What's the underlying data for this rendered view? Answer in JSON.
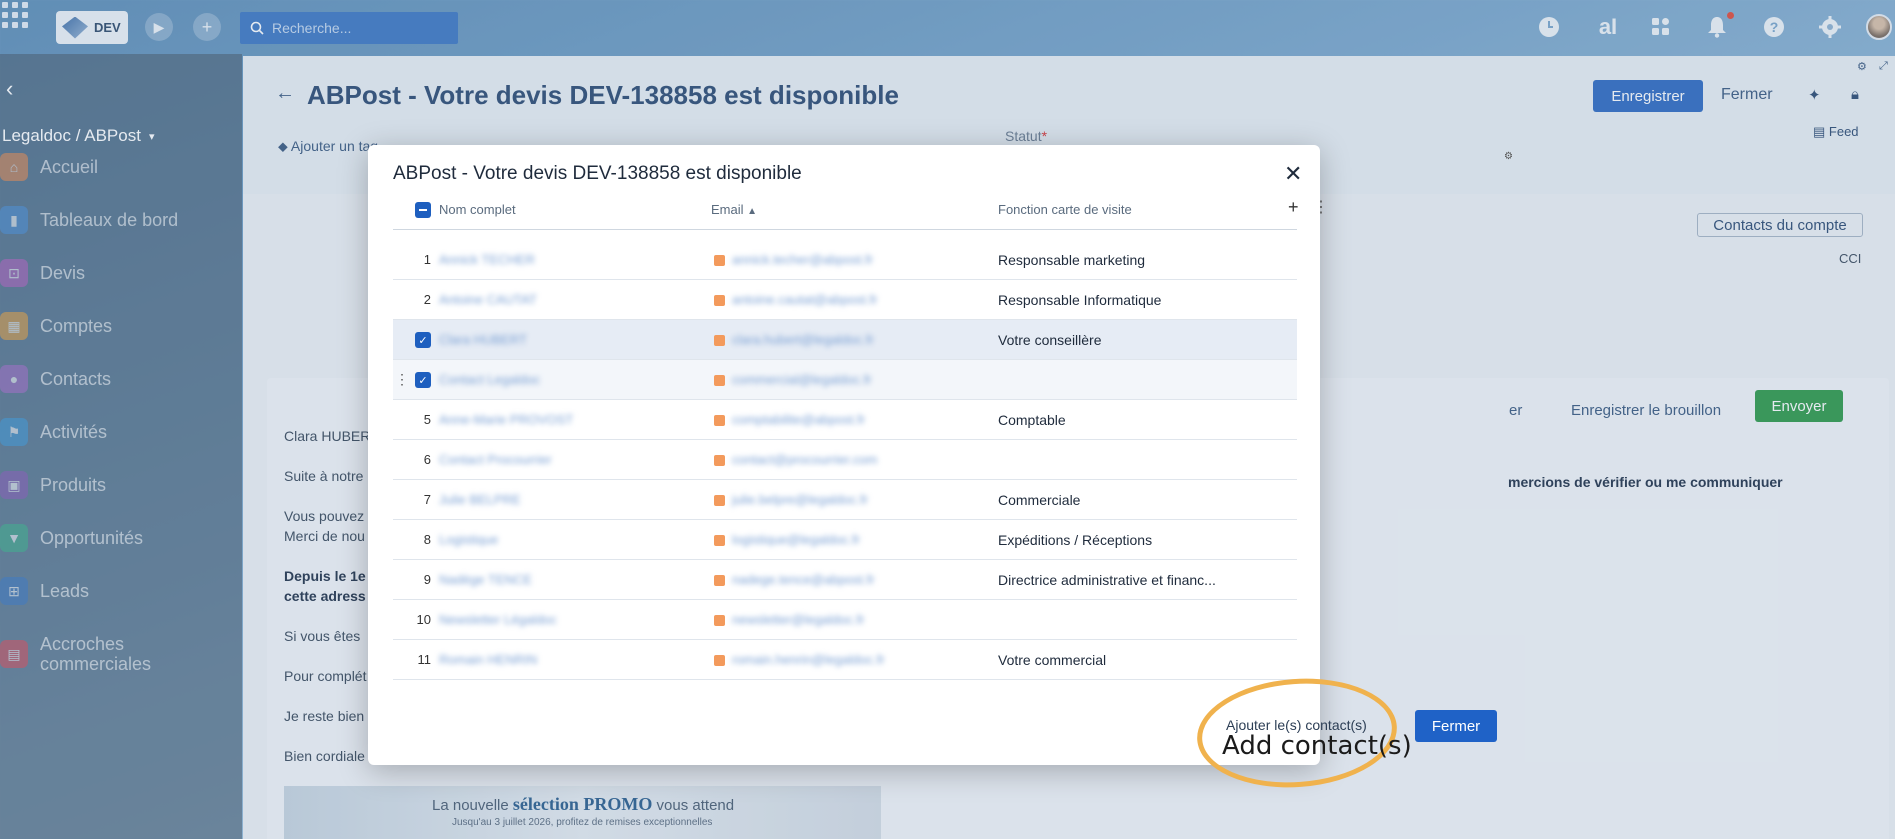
{
  "topbar": {
    "env_label": "DEV",
    "search_placeholder": "Recherche...",
    "icons": [
      "apps-grid-icon",
      "play-icon",
      "plus-icon",
      "search-icon",
      "clock-icon",
      "ai-icon",
      "widgets-icon",
      "bell-icon",
      "help-icon",
      "gear-icon",
      "avatar"
    ]
  },
  "sidebar": {
    "org": "Legaldoc / ABPost",
    "items": [
      {
        "label": "Accueil",
        "color": "#e8894b",
        "icon": "home-icon"
      },
      {
        "label": "Tableaux de bord",
        "color": "#4a8fd8",
        "icon": "chart-icon"
      },
      {
        "label": "Devis",
        "color": "#b45fbf",
        "icon": "cart-icon"
      },
      {
        "label": "Comptes",
        "color": "#e8a23d",
        "icon": "building-icon"
      },
      {
        "label": "Contacts",
        "color": "#a66cc9",
        "icon": "person-icon"
      },
      {
        "label": "Activités",
        "color": "#3d9ad8",
        "icon": "flag-icon"
      },
      {
        "label": "Produits",
        "color": "#8a5bb8",
        "icon": "box-icon"
      },
      {
        "label": "Opportunités",
        "color": "#3db38a",
        "icon": "funnel-icon"
      },
      {
        "label": "Leads",
        "color": "#3a78c4",
        "icon": "org-icon"
      },
      {
        "label": "Accroches commerciales",
        "color": "#d94c5a",
        "icon": "card-icon"
      }
    ]
  },
  "page": {
    "title": "ABPost - Votre devis DEV-138858 est disponible",
    "save_label": "Enregistrer",
    "close_label": "Fermer",
    "feed_label": "Feed",
    "add_tag_label": "Ajouter un tag",
    "status_label": "Statut",
    "required_mark": "*",
    "contacts_account_label": "Contacts du compte",
    "cci_label": "CCI",
    "draft_label": "Enregistrer le brouillon",
    "send_label": "Envoyer",
    "cut_label": "er",
    "email_lines": [
      "Clara HUBERT",
      "Suite à notre",
      "Vous pouvez",
      "Merci de nou",
      "Depuis le 1e",
      "cette adress",
      "Si vous êtes",
      "Pour complét",
      "Je reste bien",
      "Bien cordiale"
    ],
    "email_right": "mercions de vérifier ou me communiquer",
    "promo": {
      "prefix": "La nouvelle",
      "highlight": "sélection PROMO",
      "suffix": "vous attend",
      "sub": "Jusqu'au 3 juillet 2026, profitez de remises exceptionnelles"
    }
  },
  "modal": {
    "title": "ABPost - Votre devis DEV-138858 est disponible",
    "columns": {
      "name": "Nom complet",
      "email": "Email",
      "function": "Fonction carte de visite"
    },
    "rows": [
      {
        "num": "1",
        "name": "Annick TECHER",
        "email": "annick.techer@abpost.fr",
        "function": "Responsable marketing",
        "checked": false
      },
      {
        "num": "2",
        "name": "Antoine CAUTAT",
        "email": "antoine.cautat@abpost.fr",
        "function": "Responsable Informatique",
        "checked": false
      },
      {
        "num": "",
        "name": "Clara HUBERT",
        "email": "clara.hubert@legaldoc.fr",
        "function": "Votre conseillère",
        "checked": true
      },
      {
        "num": "",
        "name": "Contact Legaldoc",
        "email": "commercial@legaldoc.fr",
        "function": "",
        "checked": true
      },
      {
        "num": "5",
        "name": "Anne-Marie PROVOST",
        "email": "comptabilite@abpost.fr",
        "function": "Comptable",
        "checked": false
      },
      {
        "num": "6",
        "name": "Contact Procourrier",
        "email": "contact@procourrier.com",
        "function": "",
        "checked": false
      },
      {
        "num": "7",
        "name": "Julie BELPRE",
        "email": "julie.belpre@legaldoc.fr",
        "function": "Commerciale",
        "checked": false
      },
      {
        "num": "8",
        "name": "Logistique",
        "email": "logistique@legaldoc.fr",
        "function": "Expéditions / Réceptions",
        "checked": false
      },
      {
        "num": "9",
        "name": "Nadège TENCE",
        "email": "nadege.tence@abpost.fr",
        "function": "Directrice administrative et financ...",
        "checked": false
      },
      {
        "num": "10",
        "name": "Newsletter Légaldoc",
        "email": "newsletter@legaldoc.fr",
        "function": "",
        "checked": false
      },
      {
        "num": "11",
        "name": "Romain HENRIN",
        "email": "romain.henrin@legaldoc.fr",
        "function": "Votre commercial",
        "checked": false
      }
    ],
    "add_contacts_label": "Ajouter le(s) contact(s)",
    "close_label": "Fermer"
  },
  "annotation": {
    "text": "Add contact(s)",
    "color": "#f0b24d"
  }
}
